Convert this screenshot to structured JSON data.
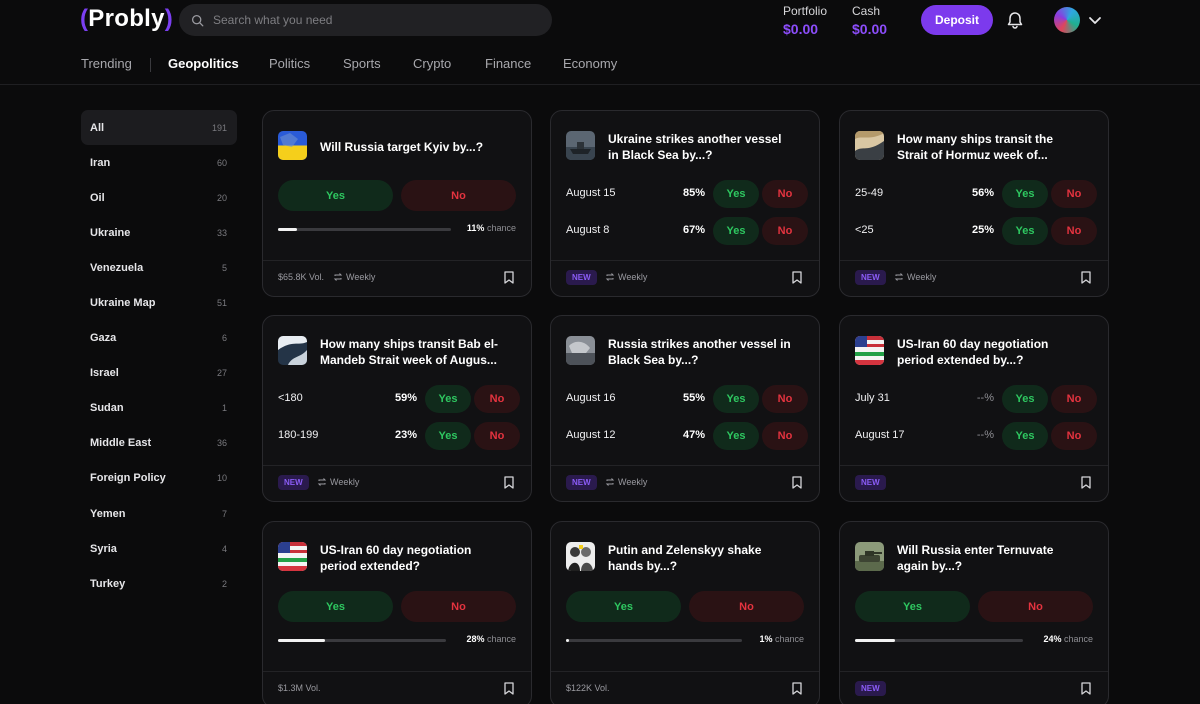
{
  "header": {
    "logo_text": "Probly",
    "search_placeholder": "Search what you need",
    "portfolio_label": "Portfolio",
    "portfolio_value": "$0.00",
    "cash_label": "Cash",
    "cash_value": "$0.00",
    "deposit_label": "Deposit"
  },
  "tabs": [
    "Trending",
    "Geopolitics",
    "Politics",
    "Sports",
    "Crypto",
    "Finance",
    "Economy"
  ],
  "active_tab": "Geopolitics",
  "sidebar": [
    {
      "name": "All",
      "count": "191"
    },
    {
      "name": "Iran",
      "count": "60"
    },
    {
      "name": "Oil",
      "count": "20"
    },
    {
      "name": "Ukraine",
      "count": "33"
    },
    {
      "name": "Venezuela",
      "count": "5"
    },
    {
      "name": "Ukraine Map",
      "count": "51"
    },
    {
      "name": "Gaza",
      "count": "6"
    },
    {
      "name": "Israel",
      "count": "27"
    },
    {
      "name": "Sudan",
      "count": "1"
    },
    {
      "name": "Middle East",
      "count": "36"
    },
    {
      "name": "Foreign Policy",
      "count": "10"
    },
    {
      "name": "Yemen",
      "count": "7"
    },
    {
      "name": "Syria",
      "count": "4"
    },
    {
      "name": "Turkey",
      "count": "2"
    }
  ],
  "labels": {
    "yes": "Yes",
    "no": "No",
    "chance": "chance",
    "new": "NEW",
    "weekly": "Weekly"
  },
  "cards": [
    {
      "title": [
        "Will Russia target Kyiv by...?"
      ],
      "type": "binary",
      "chance": "11%",
      "progress": 0.11,
      "volume": "$65.8K Vol.",
      "weekly": true
    },
    {
      "title": [
        "Ukraine strikes another vessel",
        "in Black Sea by...?"
      ],
      "type": "multi",
      "rows": [
        {
          "label": "August 15",
          "pct": "85%"
        },
        {
          "label": "August 8",
          "pct": "67%"
        }
      ],
      "new": true,
      "weekly": true
    },
    {
      "title": [
        "How many ships transit the",
        "Strait of Hormuz week of..."
      ],
      "type": "multi",
      "rows": [
        {
          "label": "25-49",
          "pct": "56%"
        },
        {
          "label": "<25",
          "pct": "25%"
        }
      ],
      "new": true,
      "weekly": true
    },
    {
      "title": [
        "How many ships transit Bab el-",
        "Mandeb Strait week of Augus..."
      ],
      "type": "multi",
      "rows": [
        {
          "label": "<180",
          "pct": "59%"
        },
        {
          "label": "180-199",
          "pct": "23%"
        }
      ],
      "new": true,
      "weekly": true
    },
    {
      "title": [
        "Russia strikes another vessel in",
        "Black Sea by...?"
      ],
      "type": "multi",
      "rows": [
        {
          "label": "August 16",
          "pct": "55%"
        },
        {
          "label": "August 12",
          "pct": "47%"
        }
      ],
      "new": true,
      "weekly": true
    },
    {
      "title": [
        "US-Iran 60 day negotiation",
        "period extended by...?"
      ],
      "type": "multi",
      "rows": [
        {
          "label": "July 31",
          "pct": "--%"
        },
        {
          "label": "August 17",
          "pct": "--%"
        }
      ],
      "new": true,
      "weekly": false
    },
    {
      "title": [
        "US-Iran 60 day negotiation",
        "period extended?"
      ],
      "type": "binary",
      "chance": "28%",
      "progress": 0.28,
      "volume": "$1.3M Vol.",
      "weekly": false
    },
    {
      "title": [
        "Putin and Zelenskyy shake",
        "hands by...?"
      ],
      "type": "binary",
      "chance": "1%",
      "progress": 0.01,
      "volume": "$122K Vol.",
      "weekly": false
    },
    {
      "title": [
        "Will Russia enter Ternuvate",
        "again by...?"
      ],
      "type": "binary",
      "chance": "24%",
      "progress": 0.24,
      "new": true,
      "weekly": false
    }
  ],
  "thumb_icons": [
    "ukraine-flag-icon",
    "ship-icon",
    "strait-map-icon",
    "satellite-map-icon",
    "vessel-photo-icon",
    "us-iran-flag-icon",
    "us-iran-flag-icon",
    "putin-zelenskyy-photo-icon",
    "tank-photo-icon"
  ],
  "colors": {
    "accent": "#7c3aed",
    "yes_text": "#2ec760",
    "no_text": "#e4333f",
    "background": "#0b0b0c"
  }
}
